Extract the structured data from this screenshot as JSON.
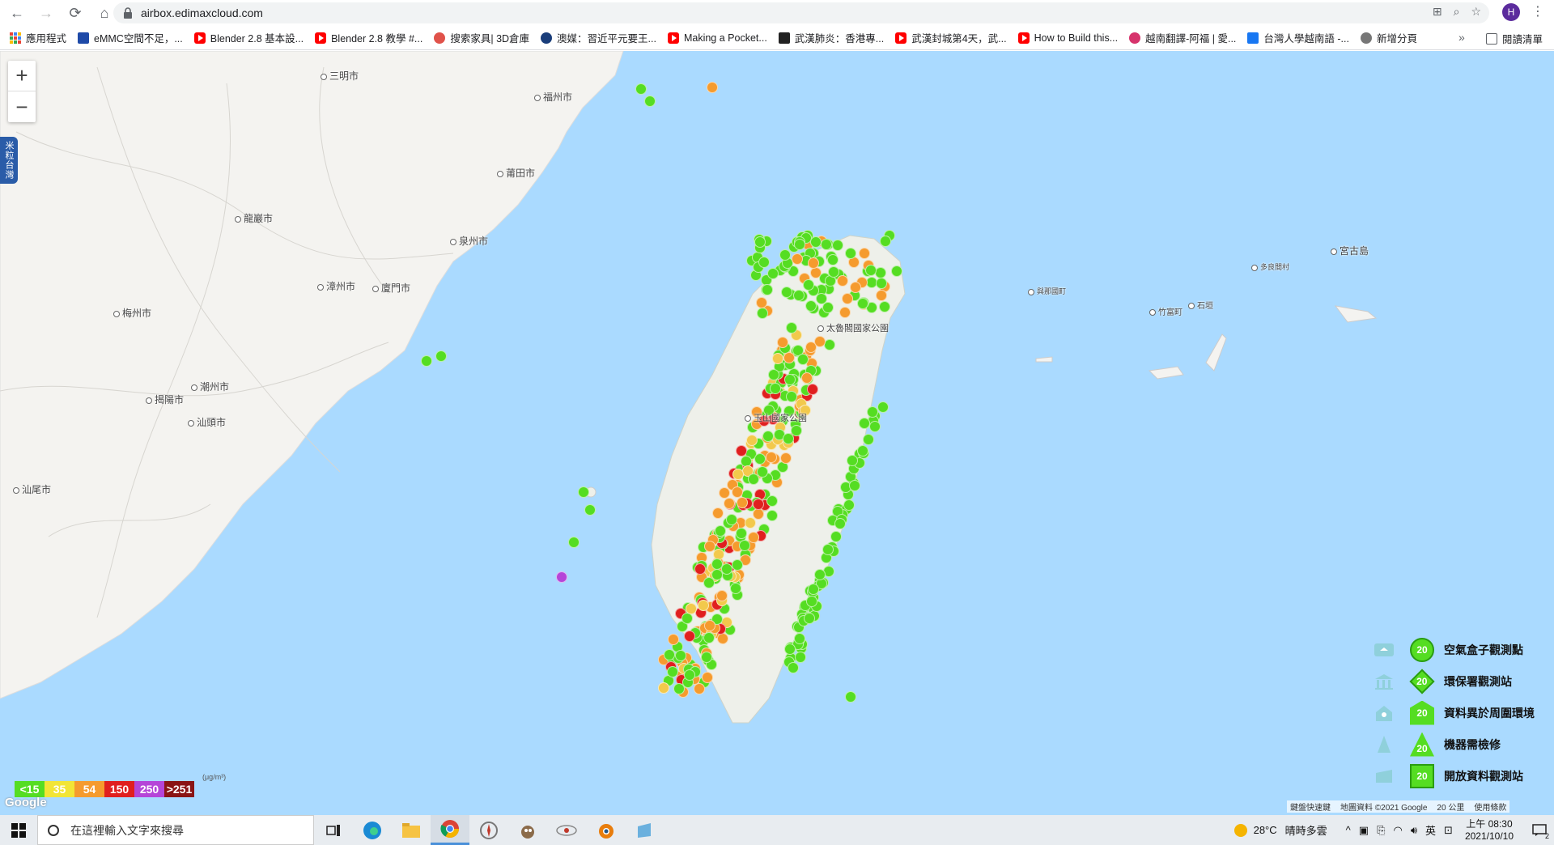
{
  "browser": {
    "url": "airbox.edimaxcloud.com",
    "profile_initial": "H"
  },
  "bookmarks": [
    {
      "label": "應用程式",
      "icon": "apps-grid-icon"
    },
    {
      "label": "eMMC空間不足，...",
      "icon": "emmc-icon"
    },
    {
      "label": "Blender 2.8 基本設...",
      "icon": "youtube-icon"
    },
    {
      "label": "Blender 2.8 教學 #...",
      "icon": "youtube-icon"
    },
    {
      "label": "搜索家具| 3D倉庫",
      "icon": "3dwarehouse-icon"
    },
    {
      "label": "澳媒：習近平元要王...",
      "icon": "news-icon"
    },
    {
      "label": "Making a Pocket...",
      "icon": "youtube-icon"
    },
    {
      "label": "武漢肺炎：香港專...",
      "icon": "bbc-icon"
    },
    {
      "label": "武漢封城第4天，武...",
      "icon": "youtube-icon"
    },
    {
      "label": "How to Build this...",
      "icon": "youtube-icon"
    },
    {
      "label": "越南翻譯-阿福 | 愛...",
      "icon": "translate-icon"
    },
    {
      "label": "台灣人學越南語 -...",
      "icon": "facebook-icon"
    },
    {
      "label": "新增分頁",
      "icon": "globe-icon"
    }
  ],
  "bookmarks_more": "»",
  "reading_list": "閱讀清單",
  "map": {
    "side_tab": "米粒台灣",
    "zoom_in": "+",
    "zoom_out": "−",
    "cities": [
      {
        "name": "三明市"
      },
      {
        "name": "福州市"
      },
      {
        "name": "莆田市"
      },
      {
        "name": "龍巖市"
      },
      {
        "name": "泉州市"
      },
      {
        "name": "漳州市"
      },
      {
        "name": "廈門市"
      },
      {
        "name": "梅州市"
      },
      {
        "name": "潮州市"
      },
      {
        "name": "揭陽市"
      },
      {
        "name": "汕頭市"
      },
      {
        "name": "汕尾市"
      },
      {
        "name": "宮古島"
      },
      {
        "name": "多良間村"
      },
      {
        "name": "與那國町"
      },
      {
        "name": "竹富町"
      },
      {
        "name": "石垣"
      },
      {
        "name": "太魯閣國家公園"
      },
      {
        "name": "玉山國家公園"
      }
    ],
    "legend": [
      {
        "label": "空氣盒子觀測點",
        "value": "20",
        "marker": "circle"
      },
      {
        "label": "環保署觀測站",
        "value": "20",
        "marker": "diamond"
      },
      {
        "label": "資料異於周圍環境",
        "value": "20",
        "marker": "house"
      },
      {
        "label": "機器需檢修",
        "value": "20",
        "marker": "triangle"
      },
      {
        "label": "開放資料觀測站",
        "value": "20",
        "marker": "square"
      }
    ],
    "scale": [
      {
        "label": "<15",
        "color": "#55dd22"
      },
      {
        "label": "35",
        "color": "#f2e536"
      },
      {
        "label": "54",
        "color": "#f59b2e"
      },
      {
        "label": "150",
        "color": "#e01f1f"
      },
      {
        "label": "250",
        "color": "#b545d8"
      },
      {
        "label": ">251",
        "color": "#8a1414"
      }
    ],
    "scale_unit": "(μg/m³)",
    "google_logo": "Google",
    "attribution": {
      "shortcuts": "鍵盤快速鍵",
      "map_data": "地圖資料 ©2021 Google",
      "scale": "20 公里",
      "terms": "使用條款"
    }
  },
  "taskbar": {
    "search_placeholder": "在這裡輸入文字來搜尋",
    "weather_temp": "28°C",
    "weather_desc": "晴時多雲",
    "ime": "英",
    "time": "上午 08:30",
    "date": "2021/10/10",
    "notifications": "2"
  }
}
